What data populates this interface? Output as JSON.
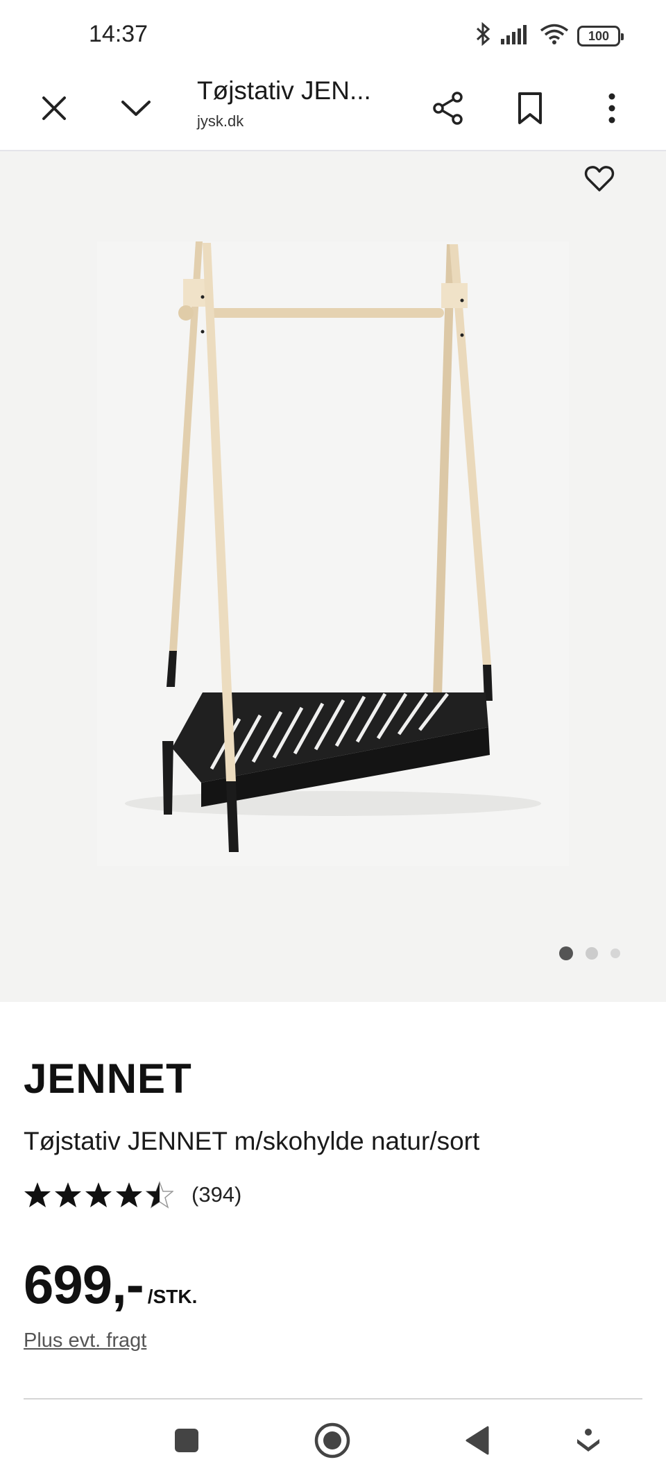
{
  "status_bar": {
    "time": "14:37",
    "battery": "100",
    "icons": [
      "bluetooth-icon",
      "signal-icon",
      "wifi-icon",
      "battery-icon"
    ]
  },
  "browser": {
    "tab_title": "Tøjstativ JEN...",
    "domain": "jysk.dk",
    "icons": [
      "close-icon",
      "chevron-down-icon",
      "share-icon",
      "bookmark-icon",
      "more-vertical-icon"
    ]
  },
  "gallery": {
    "favorite_icon": "heart-outline-icon",
    "image_count": 3,
    "active_index": 0
  },
  "product": {
    "brand": "JENNET",
    "name": "Tøjstativ JENNET m/skohylde natur/sort",
    "rating": 4.5,
    "review_count": "(394)",
    "price": "699,-",
    "price_unit": "/STK.",
    "shipping_link": "Plus evt. fragt"
  },
  "nav_bar": {
    "icons": [
      "square-icon",
      "home-circle-icon",
      "back-triangle-icon",
      "assistant-icon"
    ]
  },
  "colors": {
    "text": "#111111",
    "gallery_bg": "#f3f3f2",
    "wood": "#e8d6b8",
    "rack_black": "#1b1b1b",
    "dot_active": "#555555",
    "dot_inactive": "#cccccc"
  }
}
